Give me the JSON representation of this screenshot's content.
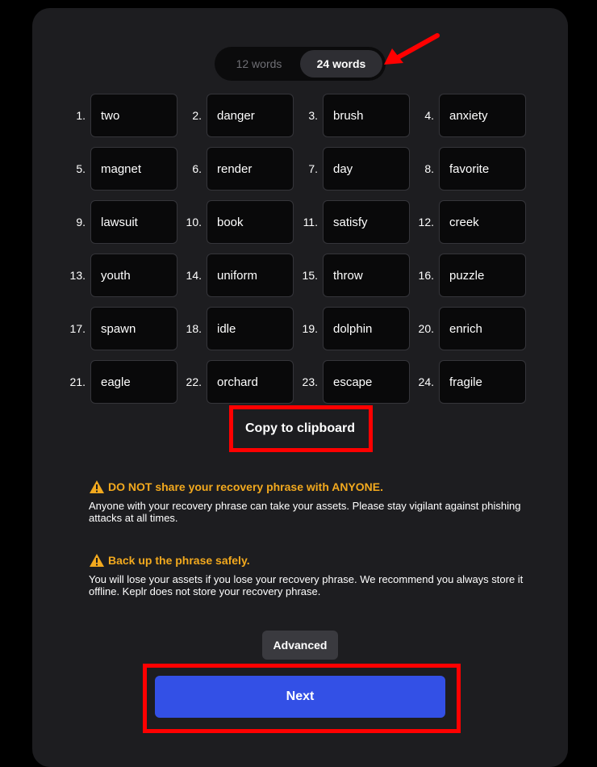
{
  "toggle": {
    "options": [
      {
        "label": "12 words",
        "active": false
      },
      {
        "label": "24 words",
        "active": true
      }
    ]
  },
  "words": [
    {
      "num": "1.",
      "word": "two"
    },
    {
      "num": "2.",
      "word": "danger"
    },
    {
      "num": "3.",
      "word": "brush"
    },
    {
      "num": "4.",
      "word": "anxiety"
    },
    {
      "num": "5.",
      "word": "magnet"
    },
    {
      "num": "6.",
      "word": "render"
    },
    {
      "num": "7.",
      "word": "day"
    },
    {
      "num": "8.",
      "word": "favorite"
    },
    {
      "num": "9.",
      "word": "lawsuit"
    },
    {
      "num": "10.",
      "word": "book"
    },
    {
      "num": "11.",
      "word": "satisfy"
    },
    {
      "num": "12.",
      "word": "creek"
    },
    {
      "num": "13.",
      "word": "youth"
    },
    {
      "num": "14.",
      "word": "uniform"
    },
    {
      "num": "15.",
      "word": "throw"
    },
    {
      "num": "16.",
      "word": "puzzle"
    },
    {
      "num": "17.",
      "word": "spawn"
    },
    {
      "num": "18.",
      "word": "idle"
    },
    {
      "num": "19.",
      "word": "dolphin"
    },
    {
      "num": "20.",
      "word": "enrich"
    },
    {
      "num": "21.",
      "word": "eagle"
    },
    {
      "num": "22.",
      "word": "orchard"
    },
    {
      "num": "23.",
      "word": "escape"
    },
    {
      "num": "24.",
      "word": "fragile"
    }
  ],
  "copy_label": "Copy to clipboard",
  "warnings": [
    {
      "icon": "warning-icon",
      "title": "DO NOT share your recovery phrase with ANYONE.",
      "body": "Anyone with your recovery phrase can take your assets. Please stay vigilant against phishing attacks at all times."
    },
    {
      "icon": "warning-icon",
      "title": "Back up the phrase safely.",
      "body": "You will lose your assets if you lose your recovery phrase. We recommend you always store it offline. Keplr does not store your recovery phrase."
    }
  ],
  "advanced_label": "Advanced",
  "next_label": "Next",
  "colors": {
    "accent": "#3350e6",
    "warning": "#f2a91e",
    "annotation": "#ff0000",
    "panel": "#1d1d20"
  }
}
